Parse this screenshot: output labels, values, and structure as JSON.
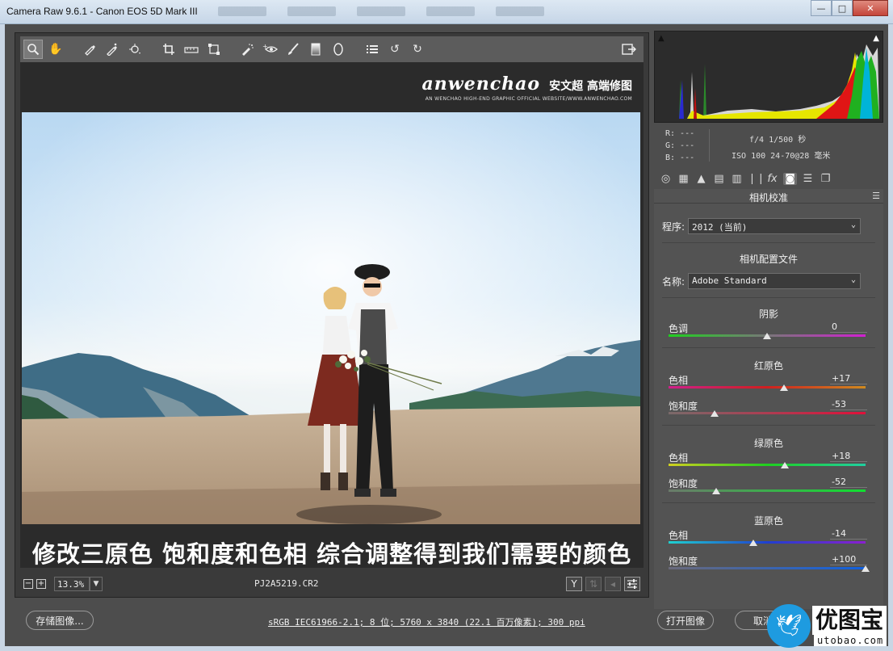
{
  "window": {
    "title": "Camera Raw 9.6.1 -  Canon EOS 5D Mark III",
    "minimize": "—",
    "maximize": "□",
    "close": "✕"
  },
  "toolbar": {
    "tools": [
      "zoom-icon",
      "hand-icon",
      "white-balance-icon",
      "color-sampler-icon",
      "targeted-adjustment-icon",
      "crop-icon",
      "straighten-icon",
      "transform-icon",
      "spot-removal-icon",
      "red-eye-icon",
      "adjustment-brush-icon",
      "graduated-filter-icon",
      "radial-filter-icon",
      "presets-list-icon",
      "rotate-ccw-icon",
      "rotate-cw-icon",
      "export-icon"
    ]
  },
  "logo": {
    "main": "anwenchao",
    "cn": "安文超 高端修图",
    "sub": "AN WENCHAO HIGH-END GRAPHIC OFFICIAL WEBSITE/WWW.ANWENCHAO.COM"
  },
  "caption": "修改三原色  饱和度和色相  综合调整得到我们需要的颜色",
  "status": {
    "zoom": "13.3%",
    "zoom_out": "−",
    "zoom_in": "+",
    "filename": "PJ2A5219.CR2",
    "y_label": "Y"
  },
  "info": {
    "r": "R:  ---",
    "g": "G:  ---",
    "b": "B:  ---",
    "aperture_shutter": "f/4   1/500 秒",
    "iso_lens": "ISO 100   24-70@28 毫米"
  },
  "panel": {
    "title": "相机校准",
    "process_label": "程序:",
    "process_value": "2012 (当前)",
    "profile_section": "相机配置文件",
    "name_label": "名称:",
    "name_value": "Adobe Standard",
    "shadows": {
      "title": "阴影",
      "tint_label": "色调",
      "tint_value": "0"
    },
    "red": {
      "title": "红原色",
      "hue_label": "色相",
      "hue_value": "+17",
      "sat_label": "饱和度",
      "sat_value": "-53"
    },
    "green": {
      "title": "绿原色",
      "hue_label": "色相",
      "hue_value": "+18",
      "sat_label": "饱和度",
      "sat_value": "-52"
    },
    "blue": {
      "title": "蓝原色",
      "hue_label": "色相",
      "hue_value": "-14",
      "sat_label": "饱和度",
      "sat_value": "+100"
    }
  },
  "sliders": {
    "shadow_tint": 0,
    "red_hue": 17,
    "red_sat": -53,
    "green_hue": 18,
    "green_sat": -52,
    "blue_hue": -14,
    "blue_sat": 100
  },
  "bottom": {
    "save_button": "存储图像...",
    "workflow_link": "sRGB IEC61966-2.1; 8 位; 5760 x 3840 (22.1 百万像素); 300 ppi",
    "open_button": "打开图像",
    "cancel_button": "取消"
  },
  "watermark": {
    "text": "优图宝",
    "url": "utobao.com"
  }
}
